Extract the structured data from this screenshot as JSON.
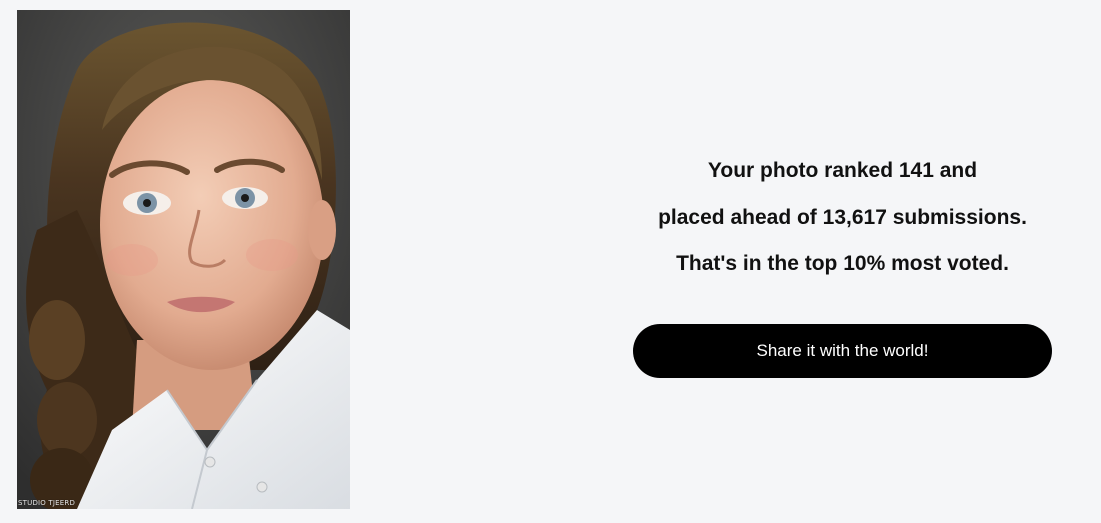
{
  "photo": {
    "alt": "Portrait photo of a girl with long curly brown hair in a white collared shirt",
    "watermark": "STUDIO TJEERD"
  },
  "result": {
    "line1": "Your photo ranked 141 and",
    "line2": "placed ahead of 13,617 submissions.",
    "line3": "That's in the top 10% most voted."
  },
  "share_button": {
    "label": "Share it with the world!"
  },
  "colors": {
    "background": "#f5f6f8",
    "button_bg": "#000000",
    "button_text": "#ffffff",
    "text": "#111111"
  }
}
